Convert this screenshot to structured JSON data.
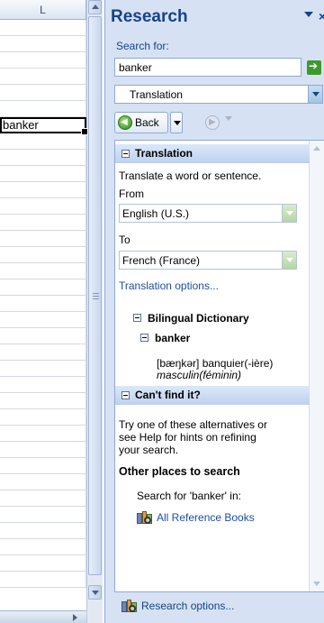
{
  "sheet": {
    "column_header": "L",
    "active_cell_value": "banker"
  },
  "pane": {
    "title": "Research",
    "close_glyph": "×",
    "search_label": "Search for:",
    "search_value": "banker",
    "service": "Translation",
    "back_label": "Back"
  },
  "translation": {
    "header": "Translation",
    "description": "Translate a word or sentence.",
    "from_label": "From",
    "from_value": "English (U.S.)",
    "to_label": "To",
    "to_value": "French (France)",
    "options_link": "Translation options..."
  },
  "dictionary": {
    "header": "Bilingual Dictionary",
    "entry_word": "banker",
    "pronunciation_translation": "[bæŋkər] banquier(-ière)",
    "gender": "masculin(féminin)"
  },
  "cant_find": {
    "header": "Can't find it?",
    "body_line1": "Try one of these alternatives or",
    "body_line2": "see Help for hints on refining",
    "body_line3": "your search.",
    "other_places": "Other places to search",
    "search_for_in": "Search for 'banker' in:",
    "all_reference_books": "All Reference Books"
  },
  "footer": {
    "research_options": "Research options..."
  },
  "colors": {
    "pane_bg": "#d6e2f3",
    "title_blue": "#15428b",
    "link_blue": "#1d4ea0",
    "go_green": "#3c9a2c"
  }
}
